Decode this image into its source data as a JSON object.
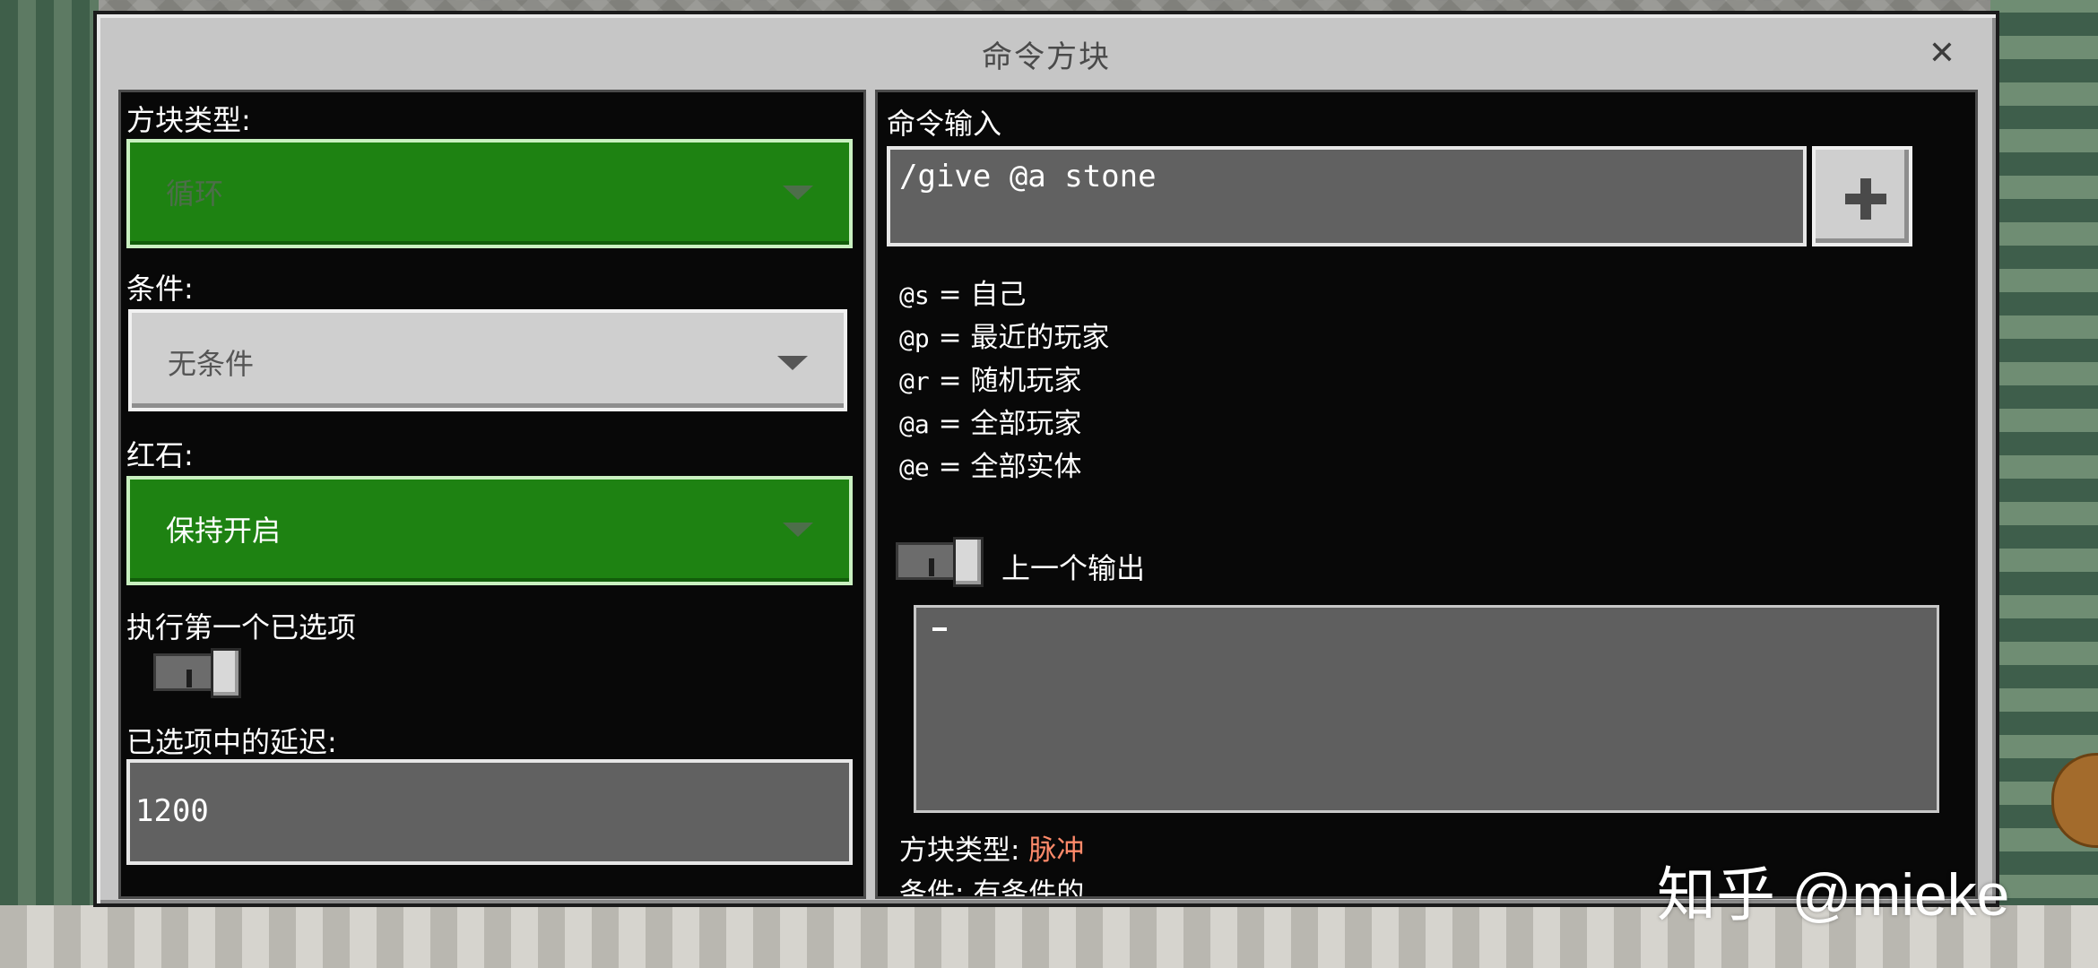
{
  "window": {
    "title": "命令方块"
  },
  "left": {
    "block_type_label": "方块类型:",
    "block_type_value": "循环",
    "condition_label": "条件:",
    "condition_value": "无条件",
    "redstone_label": "红石:",
    "redstone_value": "保持开启",
    "execute_first_label": "执行第一个已选项",
    "delay_label": "已选项中的延迟:",
    "delay_value": "1200"
  },
  "right": {
    "command_label": "命令输入",
    "command_value": "/give @a stone",
    "selectors": [
      {
        "code": "@s",
        "desc": "自己"
      },
      {
        "code": "@p",
        "desc": "最近的玩家"
      },
      {
        "code": "@r",
        "desc": "随机玩家"
      },
      {
        "code": "@a",
        "desc": "全部玩家"
      },
      {
        "code": "@e",
        "desc": "全部实体"
      }
    ],
    "previous_output_label": "上一个输出",
    "status_block_type_label": "方块类型:",
    "status_block_type_value": "脉冲",
    "status_condition_label": "条件:",
    "status_condition_value": "有条件的"
  },
  "watermark": "知乎 @mieke",
  "colors": {
    "green": "#1e8212",
    "panel": "#080808",
    "window": "#c6c6c6",
    "highlight": "#ff8a6a"
  },
  "icons": {
    "close": "close-icon",
    "plus": "plus-icon",
    "dropdown": "chevron-down-icon"
  }
}
